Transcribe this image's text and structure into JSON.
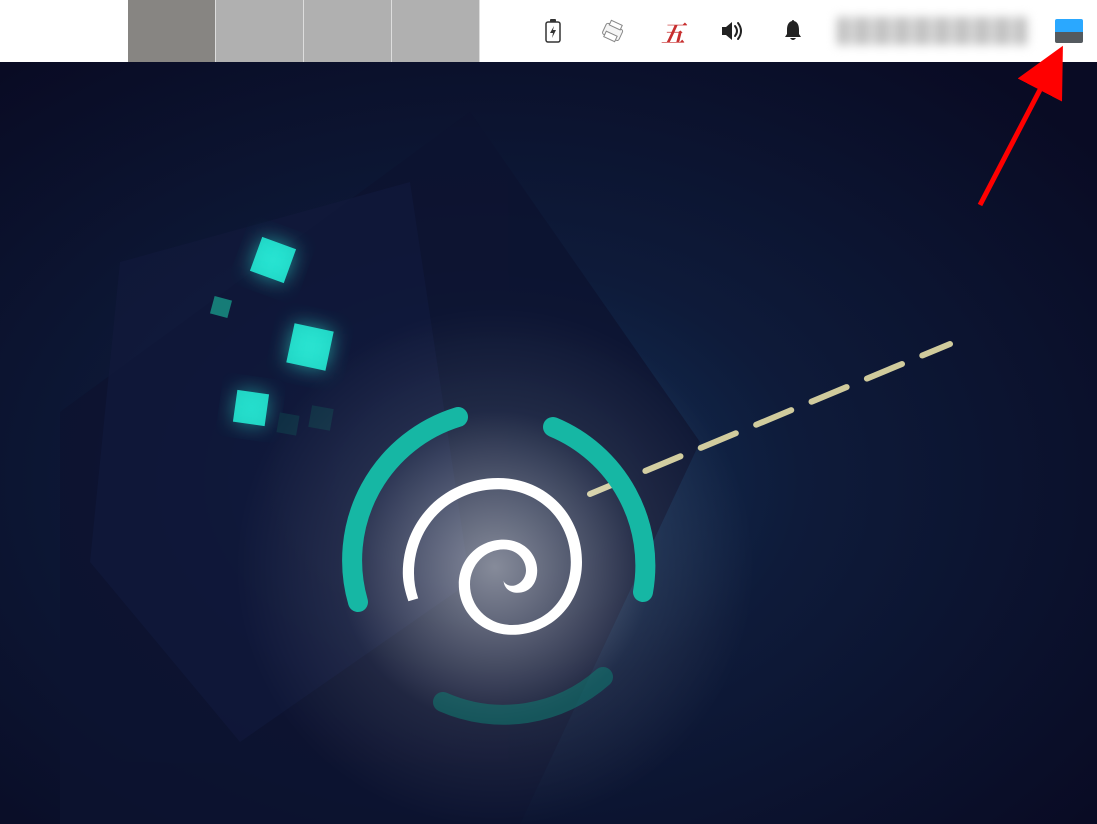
{
  "panel": {
    "workspaces": [
      {
        "active": true
      },
      {
        "active": false
      },
      {
        "active": false
      },
      {
        "active": false
      }
    ],
    "tray": {
      "battery": "battery-icon",
      "printer": "printer-icon",
      "ime_label": "五",
      "volume": "volume-icon",
      "notifications": "bell-icon",
      "clock_text": "",
      "show_desktop": "show-desktop-button"
    }
  },
  "desktop": {
    "wallpaper": "debian-logo-wallpaper"
  },
  "annotation": {
    "arrow_target": "show-desktop-button"
  }
}
